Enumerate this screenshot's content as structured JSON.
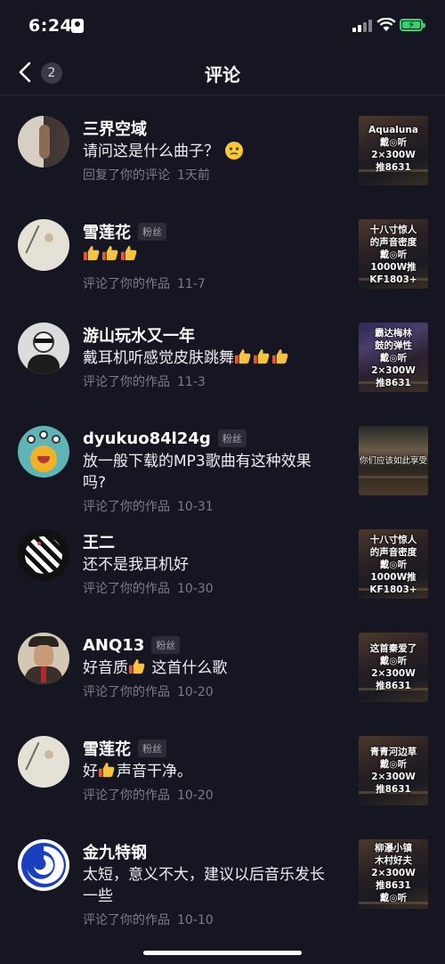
{
  "status": {
    "time": "6:24"
  },
  "nav": {
    "title": "评论",
    "badge": "2"
  },
  "comments": [
    {
      "name": "三界空域",
      "fan": "",
      "text": "请问这是什么曲子？",
      "emoji": "face",
      "action": "回复了你的评论",
      "date": "1天前",
      "thumb": [
        "Aqualuna",
        "戴◎听",
        "2×300W",
        "推8631"
      ]
    },
    {
      "name": "雪莲花",
      "fan": "粉丝",
      "text": "",
      "thumbs_up": 3,
      "action": "评论了你的作品",
      "date": "11-7",
      "thumb": [
        "十八寸惊人",
        "的声音密度",
        "戴◎听",
        "1000W推",
        "KF1803+"
      ]
    },
    {
      "name": "游山玩水又一年",
      "fan": "",
      "text": "戴耳机听感觉皮肤跳舞",
      "thumbs_up_after": 3,
      "action": "评论了你的作品",
      "date": "11-3",
      "thumb": [
        "霸达梅林",
        "鼓的弹性",
        "戴◎听",
        "2×300W",
        "推8631"
      ]
    },
    {
      "name": "dyukuo84l24g",
      "fan": "粉丝",
      "text": "放一般下载的MP3歌曲有这种效果吗?",
      "action": "评论了你的作品",
      "date": "10-31",
      "thumb": [
        "你们应该如此享受"
      ]
    },
    {
      "name": "王二",
      "fan": "",
      "text": "还不是我耳机好",
      "action": "评论了你的作品",
      "date": "10-30",
      "thumb": [
        "十八寸惊人",
        "的声音密度",
        "戴◎听",
        "1000W推",
        "KF1803+"
      ]
    },
    {
      "name": "ANQ13",
      "fan": "粉丝",
      "text_before": "好音质",
      "text": "这首什么歌",
      "action": "评论了你的作品",
      "date": "10-20",
      "thumb": [
        "这首秦爱了",
        "戴◎听",
        "2×300W",
        "推8631"
      ]
    },
    {
      "name": "雪莲花",
      "fan": "粉丝",
      "text_before": "好",
      "text": "声音干净。",
      "action": "评论了你的作品",
      "date": "10-20",
      "thumb": [
        "青青河边草",
        "戴◎听",
        "2×300W",
        "推8631"
      ]
    },
    {
      "name": "金九特钢",
      "fan": "",
      "text": "太短，意义不大，建议以后音乐发长一些",
      "action": "评论了你的作品",
      "date": "10-10",
      "thumb": [
        "柳瀑小镇",
        "木村好夫",
        "2×300W",
        "推8631",
        "戴◎听"
      ]
    }
  ]
}
